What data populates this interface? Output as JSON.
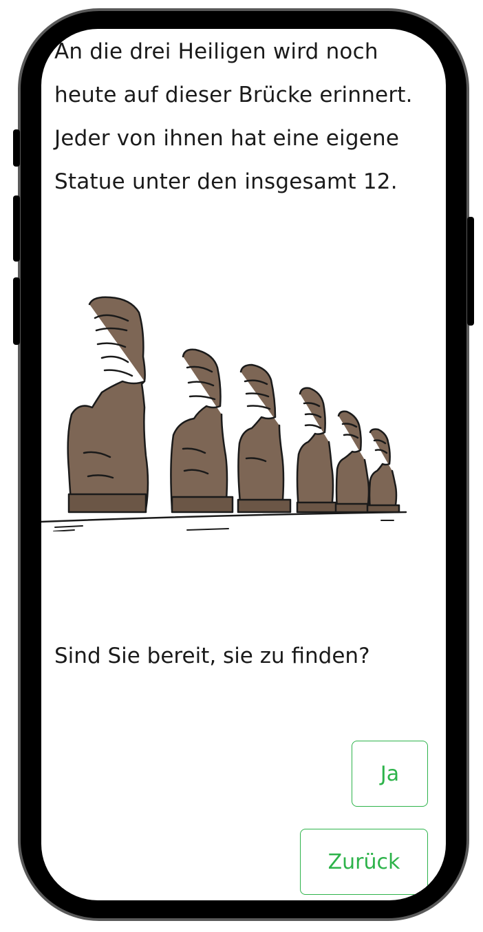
{
  "story": {
    "lines": [
      "An die drei Heiligen wird noch",
      "heute auf dieser Brücke erinnert.",
      "Jeder von ihnen hat eine eigene",
      "Statue unter den insgesamt 12."
    ],
    "question": "Sind Sie bereit, sie zu finden?"
  },
  "actions": {
    "yes_label": "Ja",
    "back_label": "Zurück"
  },
  "illustration": {
    "subject": "moai-statues",
    "statue_count": 6
  },
  "colors": {
    "accent": "#2db34a",
    "statue_fill": "#7d6655",
    "statue_outline": "#1a1a1a",
    "frame": "#000000"
  }
}
